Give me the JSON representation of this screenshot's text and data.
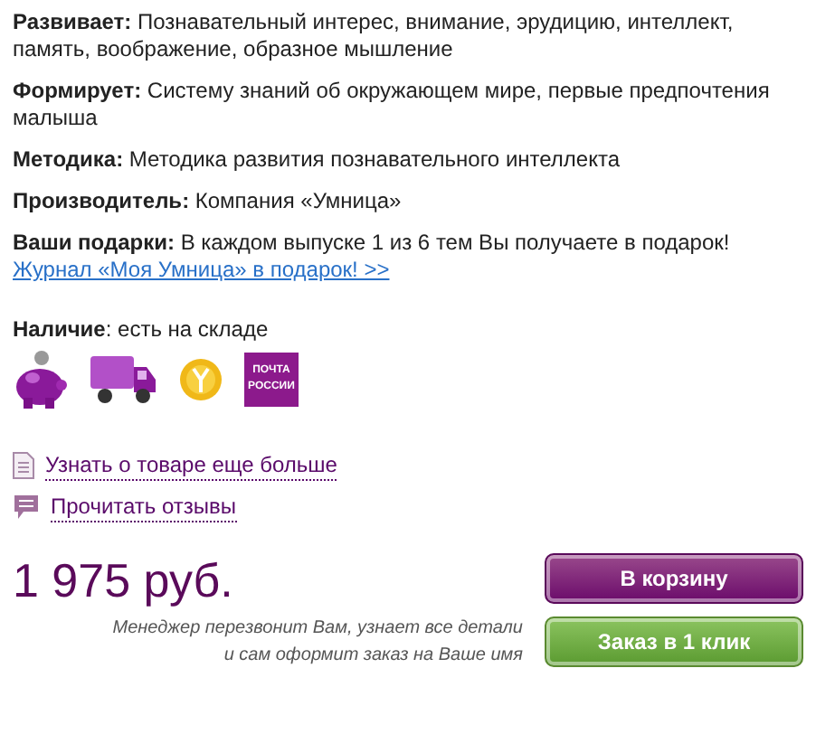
{
  "specs": [
    {
      "text": "**Развивает:** Познавательный интерес, внимание, эрудицию, интеллект, память, воображение, образное мышление"
    },
    {
      "text": "**Формирует:** Систему знаний об окружающем мире, первые предпочтения малыша"
    },
    {
      "text": "**Методика:** Методика развития познавательного интеллекта"
    },
    {
      "text": "**Производитель:** Компания «Умница»"
    },
    {
      "text": "**Ваши подарки:** В каждом выпуске 1 из 6 тем Вы получаете в подарок!",
      "link": "Журнал «Моя Умница» в подарок! >>"
    }
  ],
  "availability": "**Наличие**: есть на складе",
  "payment_icons": [
    {
      "kind": "piggy"
    },
    {
      "kind": "truck"
    },
    {
      "kind": "coin"
    },
    {
      "kind": "post",
      "text": "ПОЧТА РОССИИ"
    }
  ],
  "links": [
    {
      "kind": "document",
      "label": "Узнать о товаре еще больше"
    },
    {
      "kind": "comment",
      "label": "Прочитать отзывы"
    }
  ],
  "price": "1 975 руб.",
  "note": "Менеджер перезвонит Вам, узнает все детали и сам оформит заказ на Ваше имя",
  "buttons": [
    {
      "kind": "cart",
      "label": "В корзину"
    },
    {
      "kind": "quick",
      "label": "Заказ в 1 клик"
    }
  ]
}
